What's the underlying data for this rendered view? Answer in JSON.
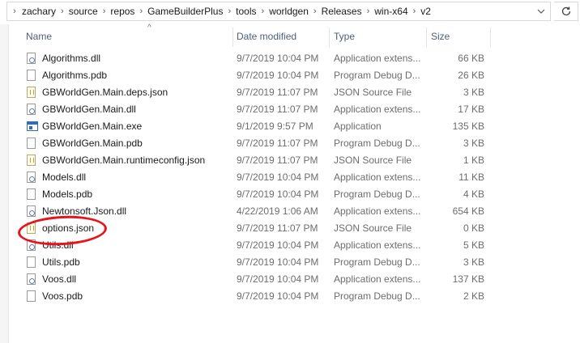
{
  "address_bar": {
    "breadcrumbs": [
      "zachary",
      "source",
      "repos",
      "GameBuilderPlus",
      "tools",
      "worldgen",
      "Releases",
      "win-x64",
      "v2"
    ]
  },
  "columns": {
    "name": "Name",
    "date": "Date modified",
    "type": "Type",
    "size": "Size"
  },
  "files": [
    {
      "name": "Algorithms.dll",
      "date": "9/7/2019 10:04 PM",
      "type": "Application extens...",
      "size": "66 KB",
      "icon": "dll"
    },
    {
      "name": "Algorithms.pdb",
      "date": "9/7/2019 10:04 PM",
      "type": "Program Debug D...",
      "size": "26 KB",
      "icon": "file"
    },
    {
      "name": "GBWorldGen.Main.deps.json",
      "date": "9/7/2019 11:07 PM",
      "type": "JSON Source File",
      "size": "3 KB",
      "icon": "json"
    },
    {
      "name": "GBWorldGen.Main.dll",
      "date": "9/7/2019 11:07 PM",
      "type": "Application extens...",
      "size": "17 KB",
      "icon": "dll"
    },
    {
      "name": "GBWorldGen.Main.exe",
      "date": "9/1/2019 9:57 PM",
      "type": "Application",
      "size": "135 KB",
      "icon": "exe"
    },
    {
      "name": "GBWorldGen.Main.pdb",
      "date": "9/7/2019 11:07 PM",
      "type": "Program Debug D...",
      "size": "3 KB",
      "icon": "file"
    },
    {
      "name": "GBWorldGen.Main.runtimeconfig.json",
      "date": "9/7/2019 11:07 PM",
      "type": "JSON Source File",
      "size": "1 KB",
      "icon": "json"
    },
    {
      "name": "Models.dll",
      "date": "9/7/2019 10:04 PM",
      "type": "Application extens...",
      "size": "11 KB",
      "icon": "dll"
    },
    {
      "name": "Models.pdb",
      "date": "9/7/2019 10:04 PM",
      "type": "Program Debug D...",
      "size": "4 KB",
      "icon": "file"
    },
    {
      "name": "Newtonsoft.Json.dll",
      "date": "4/22/2019 1:06 AM",
      "type": "Application extens...",
      "size": "654 KB",
      "icon": "dll"
    },
    {
      "name": "options.json",
      "date": "9/7/2019 11:07 PM",
      "type": "JSON Source File",
      "size": "0 KB",
      "icon": "json"
    },
    {
      "name": "Utils.dll",
      "date": "9/7/2019 10:04 PM",
      "type": "Application extens...",
      "size": "5 KB",
      "icon": "dll"
    },
    {
      "name": "Utils.pdb",
      "date": "9/7/2019 10:04 PM",
      "type": "Program Debug D...",
      "size": "3 KB",
      "icon": "file"
    },
    {
      "name": "Voos.dll",
      "date": "9/7/2019 10:04 PM",
      "type": "Application extens...",
      "size": "137 KB",
      "icon": "dll"
    },
    {
      "name": "Voos.pdb",
      "date": "9/7/2019 10:04 PM",
      "type": "Program Debug D...",
      "size": "2 KB",
      "icon": "file"
    }
  ],
  "annotation": {
    "highlighted_item": "options.json",
    "color": "#e8141b"
  }
}
